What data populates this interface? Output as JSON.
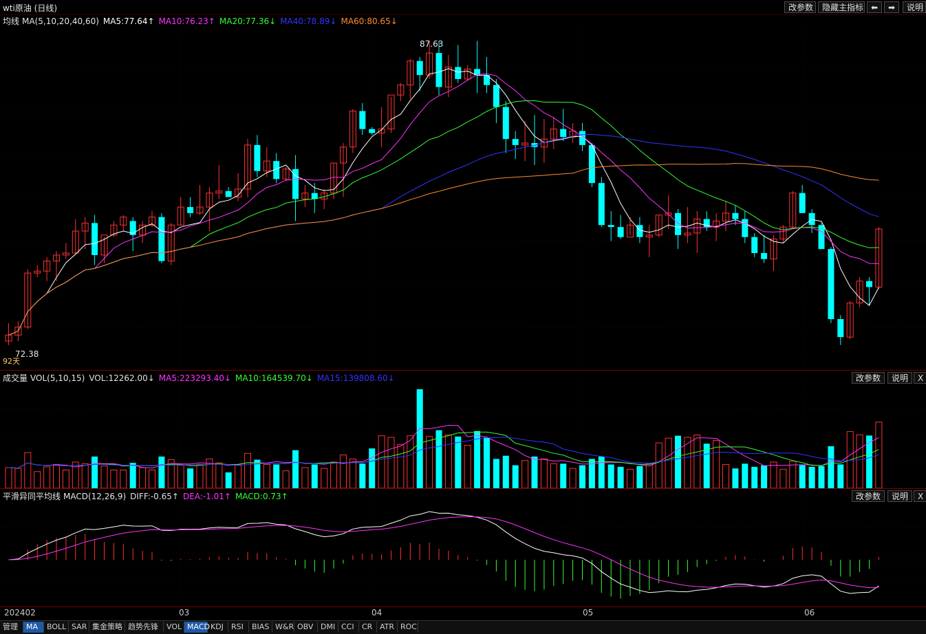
{
  "window": {
    "title": "wti原油 (日线)",
    "buttons": [
      "改参数",
      "隐藏主指标",
      "说明"
    ]
  },
  "main_panel": {
    "legend": {
      "name": "均线",
      "params": "MA(5,10,20,40,60)",
      "items": [
        {
          "text": "MA5:77.64↑",
          "color": "#ffffff"
        },
        {
          "text": "MA10:76.23↑",
          "color": "#ff33ff"
        },
        {
          "text": "MA20:77.36↓",
          "color": "#33ff33"
        },
        {
          "text": "MA40:78.89↓",
          "color": "#3333ff"
        },
        {
          "text": "MA60:80.65↓",
          "color": "#ff8c2e"
        }
      ]
    },
    "high_label": "87.63",
    "low_label": "72.38",
    "days_label": "92天"
  },
  "volume_panel": {
    "legend": {
      "name": "成交量",
      "params": "VOL(5,10,15)",
      "items": [
        {
          "text": "VOL:12262.00↓",
          "color": "#e0e0e0"
        },
        {
          "text": "MA5:223293.40↓",
          "color": "#ff33ff"
        },
        {
          "text": "MA10:164539.70↓",
          "color": "#33ff33"
        },
        {
          "text": "MA15:139808.60↓",
          "color": "#3333ff"
        }
      ]
    },
    "buttons": [
      "改参数",
      "说明",
      "X"
    ]
  },
  "macd_panel": {
    "legend": {
      "name": "平滑异同平均线",
      "params": "MACD(12,26,9)",
      "items": [
        {
          "text": "DIFF:-0.65↑",
          "color": "#e0e0e0"
        },
        {
          "text": "DEA:-1.01↑",
          "color": "#ff33ff"
        },
        {
          "text": "MACD:0.73↑",
          "color": "#33ff33"
        }
      ]
    },
    "buttons": [
      "改参数",
      "说明",
      "X"
    ]
  },
  "date_axis": [
    "202402",
    "03",
    "04",
    "05",
    "06"
  ],
  "indicator_tabs": [
    "管理",
    "MA",
    "BOLL",
    "SAR",
    "集金策略",
    "趋势先锋",
    "VOL",
    "MACD",
    "KDJ",
    "RSI",
    "BIAS",
    "W&R",
    "OBV",
    "DMI",
    "CCI",
    "CR",
    "ATR",
    "ROC"
  ],
  "active_tabs": [
    "MA",
    "MACD"
  ],
  "colors": {
    "up": "#ff3232",
    "down": "#00ffff",
    "grid": "#2a0000",
    "separator": "#7a0000"
  },
  "chart_data": {
    "type": "candlestick",
    "title": "wti原油 (日线)",
    "x": [
      "2024-02-01",
      "2024-02-02",
      "2024-02-05",
      "2024-02-06",
      "2024-02-07",
      "2024-02-08",
      "2024-02-09",
      "2024-02-12",
      "2024-02-13",
      "2024-02-14",
      "2024-02-15",
      "2024-02-16",
      "2024-02-20",
      "2024-02-21",
      "2024-02-22",
      "2024-02-23",
      "2024-02-26",
      "2024-02-27",
      "2024-02-28",
      "2024-02-29",
      "2024-03-01",
      "2024-03-04",
      "2024-03-05",
      "2024-03-06",
      "2024-03-07",
      "2024-03-08",
      "2024-03-11",
      "2024-03-12",
      "2024-03-13",
      "2024-03-14",
      "2024-03-15",
      "2024-03-18",
      "2024-03-19",
      "2024-03-20",
      "2024-03-21",
      "2024-03-22",
      "2024-03-25",
      "2024-03-26",
      "2024-03-27",
      "2024-03-28",
      "2024-04-01",
      "2024-04-02",
      "2024-04-03",
      "2024-04-04",
      "2024-04-05",
      "2024-04-08",
      "2024-04-09",
      "2024-04-10",
      "2024-04-11",
      "2024-04-12",
      "2024-04-15",
      "2024-04-16",
      "2024-04-17",
      "2024-04-18",
      "2024-04-19",
      "2024-04-22",
      "2024-04-23",
      "2024-04-24",
      "2024-04-25",
      "2024-04-26",
      "2024-04-29",
      "2024-04-30",
      "2024-05-01",
      "2024-05-02",
      "2024-05-03",
      "2024-05-06",
      "2024-05-07",
      "2024-05-08",
      "2024-05-09",
      "2024-05-10",
      "2024-05-13",
      "2024-05-14",
      "2024-05-15",
      "2024-05-16",
      "2024-05-17",
      "2024-05-20",
      "2024-05-21",
      "2024-05-22",
      "2024-05-23",
      "2024-05-24",
      "2024-05-28",
      "2024-05-29",
      "2024-05-30",
      "2024-05-31",
      "2024-06-03",
      "2024-06-04",
      "2024-06-05",
      "2024-06-06",
      "2024-06-07",
      "2024-06-10",
      "2024-06-11",
      "2024-06-12"
    ],
    "ohlc": [
      [
        72.6,
        73.5,
        72.4,
        72.9
      ],
      [
        72.9,
        73.6,
        72.6,
        73.3
      ],
      [
        73.3,
        76.2,
        73.2,
        76.0
      ],
      [
        76.0,
        76.4,
        75.8,
        76.1
      ],
      [
        76.1,
        76.8,
        75.6,
        76.6
      ],
      [
        76.6,
        77.1,
        75.6,
        76.9
      ],
      [
        76.9,
        77.5,
        76.7,
        77.0
      ],
      [
        77.0,
        78.7,
        76.9,
        78.1
      ],
      [
        78.1,
        78.8,
        77.2,
        78.5
      ],
      [
        78.5,
        78.9,
        76.4,
        76.9
      ],
      [
        76.9,
        77.8,
        76.5,
        77.9
      ],
      [
        77.9,
        78.6,
        77.8,
        78.4
      ],
      [
        78.4,
        78.9,
        78.1,
        78.8
      ],
      [
        78.6,
        78.8,
        77.1,
        77.9
      ],
      [
        77.9,
        78.6,
        77.5,
        78.4
      ],
      [
        78.4,
        79.1,
        78.3,
        78.8
      ],
      [
        78.8,
        79.0,
        76.5,
        76.6
      ],
      [
        76.6,
        78.5,
        76.4,
        78.4
      ],
      [
        78.4,
        79.8,
        78.4,
        79.3
      ],
      [
        79.3,
        79.8,
        78.8,
        79.0
      ],
      [
        79.0,
        80.4,
        78.9,
        79.3
      ],
      [
        79.3,
        80.3,
        78.1,
        80.0
      ],
      [
        80.0,
        81.4,
        79.7,
        80.1
      ],
      [
        80.1,
        80.3,
        79.8,
        79.8
      ],
      [
        79.8,
        81.0,
        79.6,
        80.2
      ],
      [
        80.2,
        82.7,
        79.8,
        82.4
      ],
      [
        82.4,
        82.9,
        80.8,
        81.1
      ],
      [
        81.1,
        82.3,
        80.8,
        81.6
      ],
      [
        81.6,
        82.0,
        80.5,
        80.7
      ],
      [
        80.7,
        81.3,
        80.6,
        81.2
      ],
      [
        81.2,
        81.9,
        78.6,
        79.7
      ],
      [
        79.7,
        80.4,
        79.3,
        80.0
      ],
      [
        80.0,
        80.5,
        79.0,
        79.7
      ],
      [
        79.7,
        80.2,
        79.2,
        80.0
      ],
      [
        80.0,
        81.5,
        79.7,
        81.5
      ],
      [
        81.5,
        82.5,
        79.8,
        82.3
      ],
      [
        82.3,
        84.2,
        82.0,
        84.1
      ],
      [
        84.1,
        84.5,
        82.9,
        83.2
      ],
      [
        83.2,
        83.3,
        82.9,
        83.0
      ],
      [
        83.0,
        84.3,
        82.3,
        83.2
      ],
      [
        83.2,
        84.8,
        83.0,
        84.9
      ],
      [
        84.9,
        85.5,
        84.6,
        85.4
      ],
      [
        85.4,
        86.7,
        84.7,
        86.6
      ],
      [
        86.6,
        86.8,
        85.1,
        85.9
      ],
      [
        85.9,
        87.6,
        85.7,
        87.0
      ],
      [
        87.0,
        87.6,
        84.9,
        85.3
      ],
      [
        85.3,
        86.9,
        84.8,
        86.3
      ],
      [
        86.3,
        87.4,
        85.5,
        85.7
      ],
      [
        85.7,
        86.4,
        85.6,
        86.2
      ],
      [
        86.2,
        87.6,
        85.0,
        85.9
      ],
      [
        85.9,
        86.8,
        85.0,
        85.4
      ],
      [
        85.4,
        85.7,
        83.5,
        84.3
      ],
      [
        84.3,
        84.6,
        82.0,
        82.7
      ],
      [
        82.7,
        83.1,
        81.7,
        82.4
      ],
      [
        82.4,
        83.6,
        81.6,
        82.5
      ],
      [
        82.5,
        83.9,
        81.4,
        82.3
      ],
      [
        82.3,
        83.7,
        81.5,
        82.7
      ],
      [
        82.7,
        83.8,
        82.2,
        83.2
      ],
      [
        83.2,
        84.2,
        82.6,
        82.8
      ],
      [
        82.8,
        83.5,
        82.5,
        83.1
      ],
      [
        83.1,
        83.5,
        82.1,
        82.4
      ],
      [
        82.4,
        82.5,
        80.3,
        80.5
      ],
      [
        80.5,
        80.8,
        78.3,
        78.4
      ],
      [
        78.4,
        79.1,
        77.6,
        78.3
      ],
      [
        78.3,
        78.9,
        77.7,
        77.8
      ],
      [
        77.8,
        78.8,
        77.9,
        78.4
      ],
      [
        78.4,
        78.8,
        77.5,
        77.8
      ],
      [
        77.8,
        78.4,
        76.8,
        77.9
      ],
      [
        77.9,
        78.9,
        77.8,
        78.9
      ],
      [
        78.9,
        79.9,
        78.2,
        79.0
      ],
      [
        79.0,
        79.2,
        77.2,
        77.9
      ],
      [
        77.9,
        79.3,
        77.5,
        78.0
      ],
      [
        78.0,
        79.1,
        77.0,
        78.7
      ],
      [
        78.7,
        79.1,
        78.1,
        78.3
      ],
      [
        78.3,
        79.0,
        77.6,
        78.6
      ],
      [
        78.6,
        79.6,
        78.1,
        79.0
      ],
      [
        79.0,
        79.4,
        78.4,
        78.7
      ],
      [
        78.7,
        79.1,
        77.5,
        77.8
      ],
      [
        77.8,
        78.0,
        76.8,
        77.0
      ],
      [
        77.0,
        77.9,
        76.5,
        76.7
      ],
      [
        76.7,
        77.9,
        76.1,
        77.7
      ],
      [
        77.7,
        78.4,
        77.5,
        78.3
      ],
      [
        78.3,
        80.1,
        78.2,
        80.0
      ],
      [
        80.0,
        80.4,
        79.0,
        79.0
      ],
      [
        79.0,
        79.2,
        78.0,
        78.4
      ],
      [
        78.4,
        78.5,
        77.2,
        77.2
      ],
      [
        77.2,
        77.3,
        73.5,
        73.7
      ],
      [
        73.7,
        73.9,
        72.4,
        72.8
      ],
      [
        72.8,
        74.6,
        72.7,
        74.5
      ],
      [
        74.5,
        75.8,
        74.3,
        75.6
      ],
      [
        75.6,
        75.8,
        74.4,
        75.3
      ],
      [
        75.3,
        78.3,
        75.2,
        78.2
      ]
    ],
    "ma5_last": 77.64,
    "ma10_last": 76.23,
    "ma20_last": 77.36,
    "ma40_last": 78.89,
    "ma60_last": 80.65,
    "price_high": 87.63,
    "price_low": 72.38,
    "volume_last": 12262.0,
    "volume_ma5_last": 223293.4,
    "volume_ma10_last": 164539.7,
    "volume_ma15_last": 139808.6,
    "macd_diff_last": -0.65,
    "macd_dea_last": -1.01,
    "macd_last": 0.73,
    "grid": true
  }
}
